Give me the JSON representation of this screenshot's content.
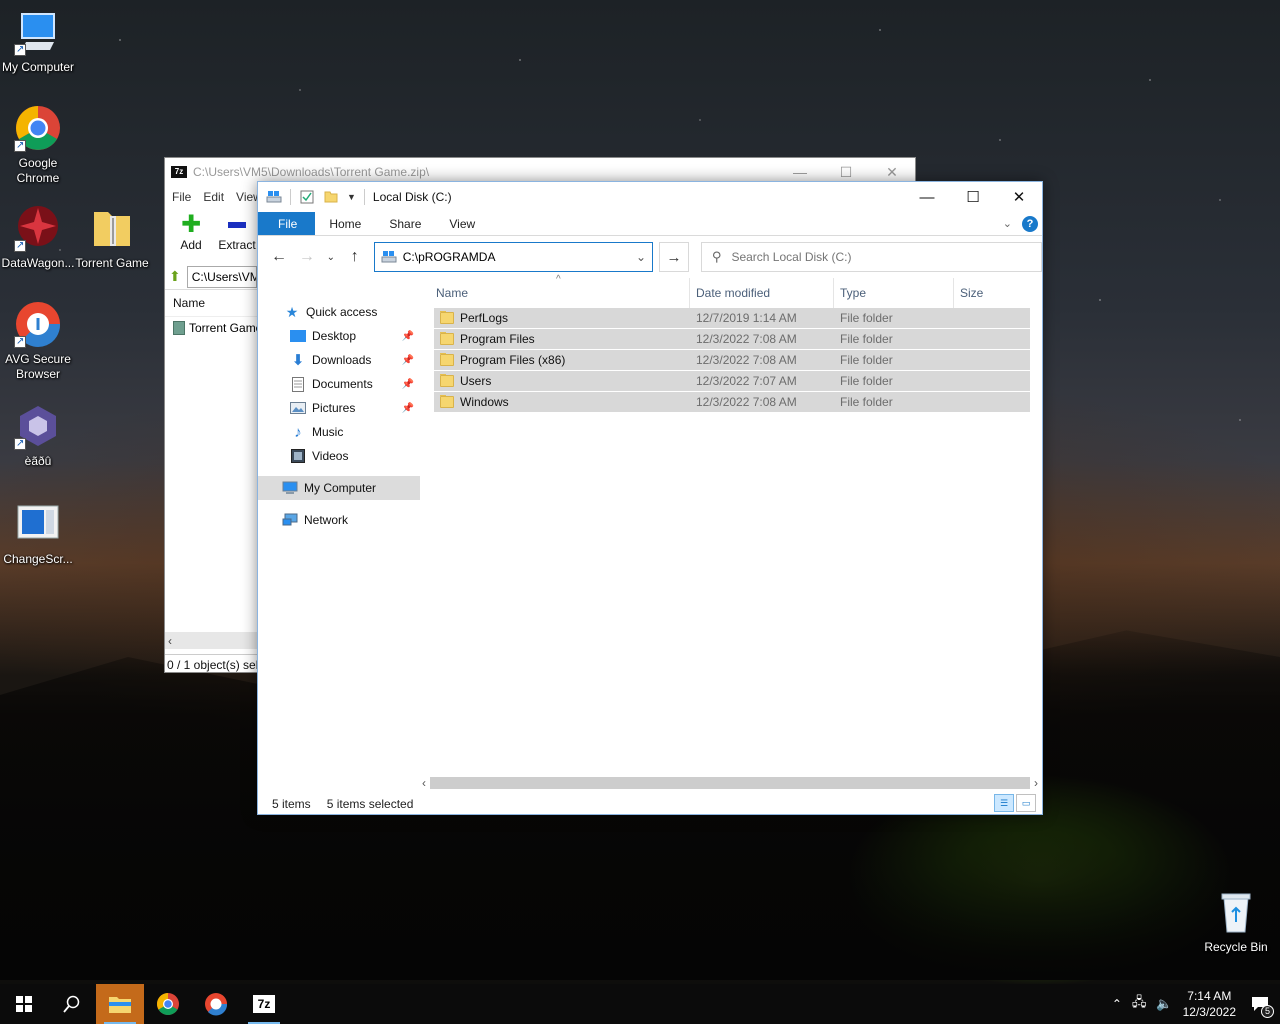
{
  "desktop": {
    "icons": [
      {
        "label": "My Computer"
      },
      {
        "label": "Google Chrome"
      },
      {
        "label": "DataWagon..."
      },
      {
        "label": "Torrent Game"
      },
      {
        "label": "AVG Secure Browser"
      },
      {
        "label": "èãðû"
      },
      {
        "label": "ChangeScr..."
      },
      {
        "label": "Recycle Bin"
      }
    ]
  },
  "zip_window": {
    "title": "C:\\Users\\VM5\\Downloads\\Torrent Game.zip\\",
    "logo": "7z",
    "menu": [
      "File",
      "Edit",
      "View"
    ],
    "tools": {
      "add": "Add",
      "extract": "Extract"
    },
    "address": "C:\\Users\\VM5\\Downloads\\Torrent Game.zip\\",
    "column_name": "Name",
    "row": "Torrent Game",
    "status": "0 / 1 object(s) selected"
  },
  "explorer": {
    "title": "Local Disk (C:)",
    "ribbon_tabs": [
      "File",
      "Home",
      "Share",
      "View"
    ],
    "address_value": "C:\\pROGRAMDA",
    "search_placeholder": "Search Local Disk (C:)",
    "nav": {
      "quick_access": "Quick access",
      "items": [
        "Desktop",
        "Downloads",
        "Documents",
        "Pictures",
        "Music",
        "Videos"
      ],
      "my_computer": "My Computer",
      "network": "Network"
    },
    "columns": {
      "name": "Name",
      "date": "Date modified",
      "type": "Type",
      "size": "Size"
    },
    "files": [
      {
        "name": "PerfLogs",
        "date": "12/7/2019 1:14 AM",
        "type": "File folder"
      },
      {
        "name": "Program Files",
        "date": "12/3/2022 7:08 AM",
        "type": "File folder"
      },
      {
        "name": "Program Files (x86)",
        "date": "12/3/2022 7:08 AM",
        "type": "File folder"
      },
      {
        "name": "Users",
        "date": "12/3/2022 7:07 AM",
        "type": "File folder"
      },
      {
        "name": "Windows",
        "date": "12/3/2022 7:08 AM",
        "type": "File folder"
      }
    ],
    "status": {
      "items": "5 items",
      "selected": "5 items selected"
    }
  },
  "taskbar": {
    "time": "7:14 AM",
    "date": "12/3/2022",
    "notification_count": "5"
  }
}
